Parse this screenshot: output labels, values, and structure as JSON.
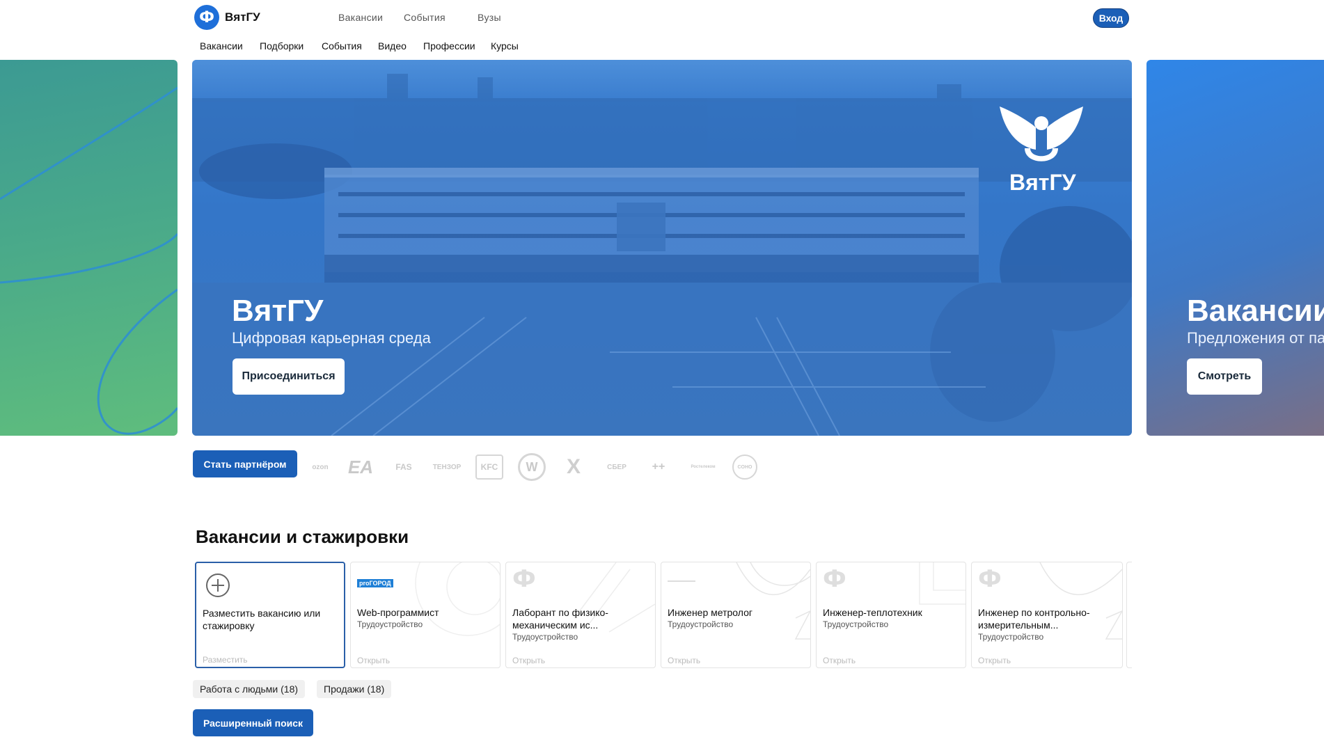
{
  "header": {
    "logo_glyph": "Ф",
    "logo_name": "ВятГУ",
    "top_nav": [
      "Вакансии",
      "События",
      "Вузы"
    ],
    "login_label": "Вход",
    "sub_nav": [
      "Вакансии",
      "Подборки",
      "События",
      "Видео",
      "Профессии",
      "Курсы"
    ]
  },
  "carousel": {
    "main": {
      "title": "ВятГУ",
      "subtitle": "Цифровая карьерная среда",
      "button": "Присоединиться",
      "emblem_text": "ВятГУ"
    },
    "next": {
      "title": "Вакансии",
      "subtitle": "Предложения от па",
      "button": "Смотреть"
    }
  },
  "partners": {
    "button": "Стать партнёром",
    "logos": [
      "ozon",
      "EA",
      "FAS",
      "ТЕНЗОР",
      "KFC",
      "W",
      "X",
      "СБЕР",
      "++",
      "Ростелеком",
      "COHO"
    ]
  },
  "vacancies": {
    "title": "Вакансии и стажировки",
    "add_card": {
      "title": "Разместить вакансию или стажировку",
      "action": "Разместить"
    },
    "cards": [
      {
        "logo": "proГОРОД",
        "title": "Web-программист",
        "type": "Трудоустройство",
        "action": "Открыть"
      },
      {
        "logo": "Ф",
        "title": "Лаборант по физико-механическим ис...",
        "type": "Трудоустройство",
        "action": "Открыть"
      },
      {
        "logo": "",
        "title": "Инженер метролог",
        "type": "Трудоустройство",
        "action": "Открыть"
      },
      {
        "logo": "Ф",
        "title": "Инженер-теплотехник",
        "type": "Трудоустройство",
        "action": "Открыть"
      },
      {
        "logo": "Ф",
        "title": "Инженер по контрольно-измерительным...",
        "type": "Трудоустройство",
        "action": "Открыть"
      }
    ],
    "chips": [
      "Работа с людьми (18)",
      "Продажи (18)"
    ],
    "search_button": "Расширенный поиск"
  },
  "colors": {
    "primary": "#1b5fb7",
    "hero_blue": "#3a7bd0"
  }
}
